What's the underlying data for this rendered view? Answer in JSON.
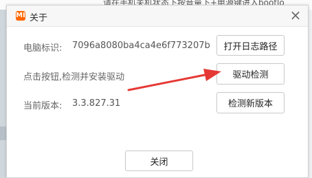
{
  "background": {
    "partial_text": "请在手机关机状态下按音量下+电源键进入bootlo"
  },
  "window": {
    "logo_text": "MI",
    "title": "关于",
    "close_glyph": "×"
  },
  "rows": [
    {
      "label": "电脑标识:",
      "value": "7096a8080ba4ca4e6f773207b",
      "button": "打开日志路径"
    },
    {
      "label": "点击按钮,检测并安装驱动",
      "value": "",
      "button": "驱动检测"
    },
    {
      "label": "当前版本:",
      "value": "3.3.827.31",
      "button": "检测新版本"
    }
  ],
  "footer": {
    "close_button": "关闭"
  },
  "colors": {
    "brand": "#ff6700",
    "annotation_arrow": "#e53935"
  }
}
